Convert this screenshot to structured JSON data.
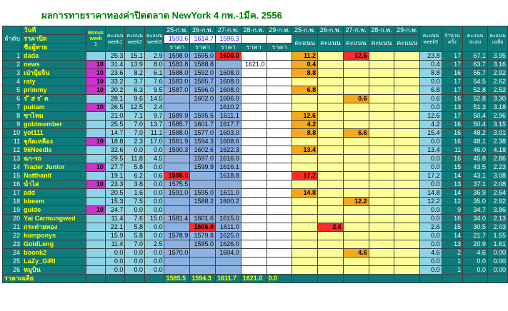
{
  "title": "ผลการทายราคาทองค่าปิดตลาด NewYork 4 กพ.-1มีค. 2556",
  "header": {
    "rank_label": "ลำดับ",
    "day_label": "วันที่",
    "close_label": "ราคาปิด",
    "member_label": "ชื่อผู้ทาย",
    "bonus_label": "Bonus week 1",
    "score_w1": "คะแนน week1",
    "score_w2": "คะแนน week2",
    "score_w3": "คะแนน week3",
    "dates": [
      "25-ก.พ.",
      "26-ก.พ.",
      "27-ก.พ.",
      "28-ก.พ.",
      "29-ก.พ."
    ],
    "close_prices": [
      "1593.6",
      "1614.7",
      "1596.3",
      "",
      ""
    ],
    "price_label": "ราคา",
    "score_label": "คะแนน",
    "score_w5": "คะแนน week5",
    "count_label": "จำนวน ครั้ง",
    "total_label": "คะแนน สะสม",
    "avg_label": "คะแนน เฉลี่ย"
  },
  "rows": [
    {
      "rank": "1",
      "name": "dada",
      "bonus": "",
      "w1": "25.3",
      "w2": "15.1",
      "w3": "2.9",
      "p": [
        "1598.0",
        "1595.0",
        "1600.0",
        "",
        ""
      ],
      "s": [
        "11.2",
        "",
        "12.6",
        "",
        ""
      ],
      "w5": "23.8",
      "cnt": "17",
      "tot": "67.1",
      "avg": "3.95"
    },
    {
      "rank": "2",
      "name": "news",
      "bonus": "10",
      "w1": "31.4",
      "w2": "13.9",
      "w3": "8.0",
      "p": [
        "1583.8",
        "1588.8",
        "",
        "1621.0",
        ""
      ],
      "s": [
        "0.4",
        "",
        "",
        "",
        ""
      ],
      "w5": "0.4",
      "cnt": "17",
      "tot": "63.7",
      "avg": "3.16"
    },
    {
      "rank": "3",
      "name": "เป่าปุ้ยจิ้น",
      "bonus": "10",
      "w1": "23.6",
      "w2": "8.2",
      "w3": "6.1",
      "p": [
        "1588.0",
        "1592.0",
        "1608.0",
        "",
        ""
      ],
      "s": [
        "8.8",
        "",
        "",
        "",
        ""
      ],
      "w5": "8.8",
      "cnt": "16",
      "tot": "56.7",
      "avg": "2.92"
    },
    {
      "rank": "4",
      "name": "raty",
      "bonus": "10",
      "w1": "33.2",
      "w2": "3.7",
      "w3": "7.6",
      "p": [
        "1583.0",
        "1585.7",
        "1608.0",
        "",
        ""
      ],
      "s": [
        "",
        "",
        "",
        "",
        ""
      ],
      "w5": "0.0",
      "cnt": "17",
      "tot": "54.5",
      "avg": "2.62"
    },
    {
      "rank": "5",
      "name": "primmy",
      "bonus": "10",
      "w1": "20.2",
      "w2": "6.3",
      "w3": "9.5",
      "p": [
        "1587.0",
        "1596.0",
        "1608.0",
        "",
        ""
      ],
      "s": [
        "6.8",
        "",
        "",
        "",
        ""
      ],
      "w5": "6.8",
      "cnt": "17",
      "tot": "52.8",
      "avg": "2.52"
    },
    {
      "rank": "6",
      "name": "ร ี ส ร ั ต",
      "bonus": "",
      "w1": "28.1",
      "w2": "9.6",
      "w3": "14.5",
      "p": [
        "",
        "1602.0",
        "1606.0",
        "",
        ""
      ],
      "s": [
        "",
        "",
        "0.6",
        "",
        ""
      ],
      "w5": "0.6",
      "cnt": "16",
      "tot": "52.8",
      "avg": "3.30"
    },
    {
      "rank": "7",
      "name": "puitam",
      "bonus": "10",
      "w1": "26.5",
      "w2": "12.5",
      "w3": "2.4",
      "p": [
        "",
        "",
        "1610.2",
        "",
        ""
      ],
      "s": [
        "",
        "",
        "",
        "",
        ""
      ],
      "w5": "0.0",
      "cnt": "13",
      "tot": "51.3",
      "avg": "3.18"
    },
    {
      "rank": "8",
      "name": "ชาไหม",
      "bonus": "",
      "w1": "21.0",
      "w2": "7.1",
      "w3": "9.7",
      "p": [
        "1589.9",
        "1595.5",
        "1611.1",
        "",
        ""
      ],
      "s": [
        "12.6",
        "",
        "",
        "",
        ""
      ],
      "w5": "12.6",
      "cnt": "17",
      "tot": "50.4",
      "avg": "2.96"
    },
    {
      "rank": "9",
      "name": "goldmember",
      "bonus": "",
      "w1": "25.5",
      "w2": "7.0",
      "w3": "13.7",
      "p": [
        "1585.7",
        "1601.7",
        "1617.7",
        "",
        ""
      ],
      "s": [
        "4.2",
        "",
        "",
        "",
        ""
      ],
      "w5": "4.2",
      "cnt": "16",
      "tot": "50.4",
      "avg": "3.15"
    },
    {
      "rank": "10",
      "name": "yot111",
      "bonus": "",
      "w1": "14.7",
      "w2": "7.0",
      "w3": "11.1",
      "p": [
        "1588.0",
        "1577.0",
        "1603.0",
        "",
        ""
      ],
      "s": [
        "8.8",
        "",
        "6.6",
        "",
        ""
      ],
      "w5": "15.4",
      "cnt": "16",
      "tot": "48.2",
      "avg": "3.01"
    },
    {
      "rank": "11",
      "name": "จุกัดเหลือง",
      "bonus": "10",
      "w1": "18.8",
      "w2": "2.3",
      "w3": "17.0",
      "p": [
        "1581.9",
        "1594.3",
        "1608.6",
        "",
        ""
      ],
      "s": [
        "",
        "",
        "",
        "",
        ""
      ],
      "w5": "0.0",
      "cnt": "16",
      "tot": "48.1",
      "avg": "2.38"
    },
    {
      "rank": "12",
      "name": "96Needle",
      "bonus": "",
      "w1": "32.6",
      "w2": "0.0",
      "w3": "0.0",
      "p": [
        "1590.3",
        "1602.6",
        "1622.3",
        "",
        ""
      ],
      "s": [
        "13.4",
        "",
        "",
        "",
        ""
      ],
      "w5": "13.4",
      "cnt": "11",
      "tot": "46.0",
      "avg": "4.18"
    },
    {
      "rank": "13",
      "name": "ฉก-รถ",
      "bonus": "",
      "w1": "29.5",
      "w2": "11.8",
      "w3": "4.5",
      "p": [
        "",
        "1597.0",
        "1616.0",
        "",
        ""
      ],
      "s": [
        "",
        "",
        "",
        "",
        ""
      ],
      "w5": "0.0",
      "cnt": "16",
      "tot": "45.8",
      "avg": "2.86"
    },
    {
      "rank": "14",
      "name": "Trader Junior",
      "bonus": "10",
      "w1": "27.7",
      "w2": "5.8",
      "w3": "0.0",
      "p": [
        "",
        "1599.9",
        "1616.1",
        "",
        ""
      ],
      "s": [
        "",
        "",
        "",
        "",
        ""
      ],
      "w5": "0.0",
      "cnt": "15",
      "tot": "43.5",
      "avg": "2.23"
    },
    {
      "rank": "15",
      "name": "Natthanit",
      "bonus": "",
      "w1": "19.1",
      "w2": "6.2",
      "w3": "0.6",
      "p": [
        "1595.0",
        "",
        "1618.8",
        "",
        ""
      ],
      "s": [
        "17.2",
        "",
        "",
        "",
        ""
      ],
      "w5": "17.2",
      "cnt": "14",
      "tot": "43.1",
      "avg": "3.08"
    },
    {
      "rank": "16",
      "name": "น้ำไส",
      "bonus": "10",
      "w1": "23.3",
      "w2": "3.8",
      "w3": "0.0",
      "p": [
        "1575.5",
        "",
        "",
        "",
        ""
      ],
      "s": [
        "",
        "",
        "",
        "",
        ""
      ],
      "w5": "0.0",
      "cnt": "13",
      "tot": "37.1",
      "avg": "2.08"
    },
    {
      "rank": "17",
      "name": "add",
      "bonus": "",
      "w1": "20.5",
      "w2": "1.6",
      "w3": "0.0",
      "p": [
        "1591.0",
        "1595.0",
        "1611.0",
        "",
        ""
      ],
      "s": [
        "14.8",
        "",
        "",
        "",
        ""
      ],
      "w5": "14.8",
      "cnt": "14",
      "tot": "36.9",
      "avg": "2.64"
    },
    {
      "rank": "18",
      "name": "bbeem",
      "bonus": "",
      "w1": "15.3",
      "w2": "7.5",
      "w3": "0.0",
      "p": [
        "",
        "1588.2",
        "1600.2",
        "",
        ""
      ],
      "s": [
        "",
        "",
        "12.2",
        "",
        ""
      ],
      "w5": "12.2",
      "cnt": "12",
      "tot": "35.0",
      "avg": "2.92"
    },
    {
      "rank": "19",
      "name": "guide",
      "bonus": "10",
      "w1": "24.7",
      "w2": "0.0",
      "w3": "0.0",
      "p": [
        "",
        "",
        "",
        "",
        ""
      ],
      "s": [
        "",
        "",
        "",
        "",
        ""
      ],
      "w5": "0.0",
      "cnt": "9",
      "tot": "34.7",
      "avg": "3.86"
    },
    {
      "rank": "20",
      "name": "Yai Carmungwed",
      "bonus": "",
      "w1": "11.4",
      "w2": "7.6",
      "w3": "15.0",
      "p": [
        "1581.4",
        "1601.6",
        "1615.0",
        "",
        ""
      ],
      "s": [
        "",
        "",
        "",
        "",
        ""
      ],
      "w5": "0.0",
      "cnt": "16",
      "tot": "34.0",
      "avg": "2.13"
    },
    {
      "rank": "21",
      "name": "กระต่ายทอง",
      "bonus": "",
      "w1": "22.1",
      "w2": "5.8",
      "w3": "0.0",
      "p": [
        "",
        "1606.0",
        "1611.0",
        "",
        ""
      ],
      "s": [
        "",
        "2.6",
        "",
        "",
        ""
      ],
      "w5": "2.6",
      "cnt": "15",
      "tot": "30.5",
      "avg": "2.03"
    },
    {
      "rank": "22",
      "name": "kumponys",
      "bonus": "",
      "w1": "15.9",
      "w2": "5.8",
      "w3": "0.0",
      "p": [
        "1578.9",
        "1579.8",
        "1625.0",
        "",
        ""
      ],
      "s": [
        "",
        "",
        "",
        "",
        ""
      ],
      "w5": "0.0",
      "cnt": "14",
      "tot": "21.7",
      "avg": "1.55"
    },
    {
      "rank": "23",
      "name": "GoldLeng",
      "bonus": "",
      "w1": "11.4",
      "w2": "7.0",
      "w3": "2.5",
      "p": [
        "",
        "1595.0",
        "1626.0",
        "",
        ""
      ],
      "s": [
        "",
        "",
        "",
        "",
        ""
      ],
      "w5": "0.0",
      "cnt": "13",
      "tot": "20.9",
      "avg": "1.61"
    },
    {
      "rank": "24",
      "name": "boonk2",
      "bonus": "",
      "w1": "0.0",
      "w2": "0.0",
      "w3": "0.0",
      "p": [
        "1570.0",
        "",
        "1604.0",
        "",
        ""
      ],
      "s": [
        "",
        "",
        "4.6",
        "",
        ""
      ],
      "w5": "4.6",
      "cnt": "2",
      "tot": "4.6",
      "avg": "0.00"
    },
    {
      "rank": "25",
      "name": "LaZy_GiRl",
      "bonus": "",
      "w1": "0.0",
      "w2": "0.0",
      "w3": "0.0",
      "p": [
        "",
        "",
        "",
        "",
        ""
      ],
      "s": [
        "",
        "",
        "",
        "",
        ""
      ],
      "w5": "0.0",
      "cnt": "1",
      "tot": "0.0",
      "avg": "0.00"
    },
    {
      "rank": "26",
      "name": "หมูบิน",
      "bonus": "",
      "w1": "0.0",
      "w2": "0.0",
      "w3": "0.0",
      "p": [
        "",
        "",
        "",
        "",
        ""
      ],
      "s": [
        "",
        "",
        "",
        "",
        ""
      ],
      "w5": "0.0",
      "cnt": "1",
      "tot": "0.0",
      "avg": "0.00"
    }
  ],
  "footer": {
    "label": "ราคาเฉลี่ย",
    "avg_prices": [
      "1585.5",
      "1594.3",
      "1611.7",
      "1621.0",
      "0.0"
    ]
  },
  "highlights": {
    "orange": "#f7a81b",
    "red": "#ff2a2a",
    "bonus_purple": "#cc33cc",
    "teal": "#0f7a7a"
  }
}
